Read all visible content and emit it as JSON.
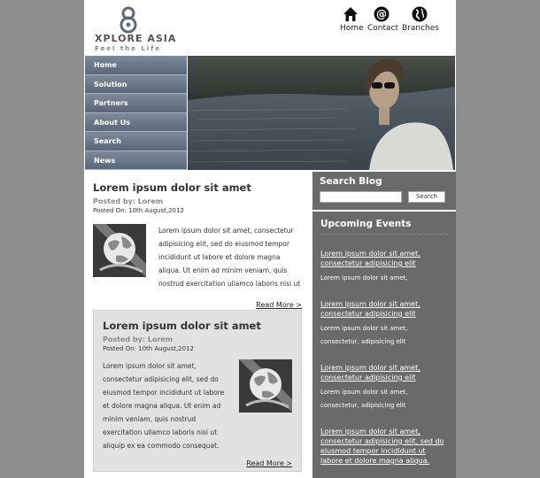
{
  "site": {
    "logo_name": "XPLORE ASIA",
    "logo_tagline": "Feel the Life"
  },
  "topnav": [
    {
      "label": "Home",
      "icon": "home-icon"
    },
    {
      "label": "Contact",
      "icon": "at-sign-icon"
    },
    {
      "label": "Branches",
      "icon": "globe-icon"
    }
  ],
  "menu": [
    "Home",
    "Solution",
    "Partners",
    "About Us",
    "Search",
    "News"
  ],
  "posts": [
    {
      "title": "Lorem ipsum dolor sit amet",
      "posted_by": "Posted by: Lorem",
      "posted_on": "Posted On: 10th August,2012",
      "body": "Lorem ipsum dolor sit amet, consectetur adipisicing elit, sed do eiusmod tempor incididunt ut labore et dolore magna aliqua. Ut enim ad minim veniam, quis nostrud exercitation ullamco laboris nisi ut",
      "read_more": "Read More >"
    },
    {
      "title": "Lorem ipsum dolor sit amet",
      "posted_by": "Posted by: Lorem",
      "posted_on": "Posted On: 10th August,2012",
      "body": "Lorem ipsum dolor sit amet, consectetur adipisicing elit, sed do eiusmod tempor incididunt ut labore et dolore magna aliqua. Ut enim ad minim veniam, quis nostrud exercitation ullamco laboris nisi ut aliquip ex ea commodo consequat.",
      "read_more": "Read More >"
    }
  ],
  "search": {
    "title": "Search Blog",
    "input_value": "",
    "button_label": "Search"
  },
  "events": {
    "title": "Upcoming Events",
    "items": [
      {
        "link": "Lorem ipsum dolor sit amet, consectetur adipisicing elit",
        "desc": "Lorem ipsum dolor sit amet,"
      },
      {
        "link": "Lorem ipsum dolor sit amet, consectetur adipisicing elit",
        "desc": "Lorem ipsum dolor sit amet, consectetur, adipisicing elit"
      },
      {
        "link": "Lorem ipsum dolor sit amet, consectetur adipisicing elit",
        "desc": "Lorem ipsum dolor sit amet, consectetur, adipisicing elit"
      },
      {
        "link": "Lorem ipsum dolor sit amet, consectetur adipisicing elit, sed do eiusmod tempor incididunt ut labore et dolore magna aliqua.",
        "desc": ""
      }
    ]
  }
}
